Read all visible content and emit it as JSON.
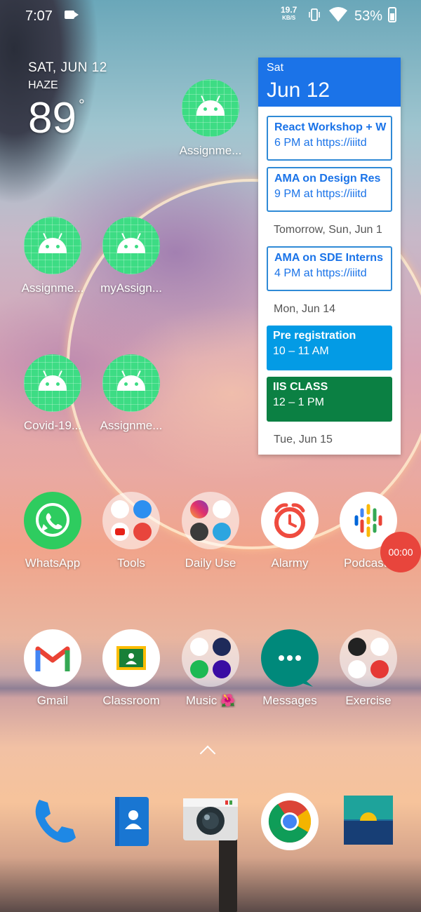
{
  "status_bar": {
    "time": "7:07",
    "net_speed": "19.7",
    "net_unit": "KB/S",
    "battery": "53%"
  },
  "weather": {
    "date": "SAT, JUN 12",
    "condition": "HAZE",
    "temperature": "89",
    "degree": "°"
  },
  "calendar": {
    "day": "Sat",
    "date": "Jun 12",
    "events": [
      {
        "title": "React Workshop + W",
        "time": "6 PM at https://iiitd"
      },
      {
        "title": "AMA on Design Res",
        "time": "9 PM at https://iiitd"
      }
    ],
    "tomorrow_label": "Tomorrow, Sun, Jun 1",
    "tomorrow_events": [
      {
        "title": "AMA on SDE Interns",
        "time": "4 PM at https://iiitd"
      }
    ],
    "mon_label": "Mon, Jun 14",
    "mon_events": [
      {
        "title": "Pre registration",
        "time": "10 – 11 AM"
      },
      {
        "title": "IIS CLASS",
        "time": "12 – 1 PM"
      }
    ],
    "tue_label": "Tue, Jun 15"
  },
  "apps": {
    "assign_top": "Assignme...",
    "assign_a": "Assignme...",
    "my_assign": "myAssign...",
    "covid": "Covid-19...",
    "assign_b": "Assignme...",
    "whatsapp": "WhatsApp",
    "tools": "Tools",
    "daily_use": "Daily Use",
    "alarmy": "Alarmy",
    "podcasts": "Podcasts",
    "gmail": "Gmail",
    "classroom": "Classroom",
    "music": "Music 🌺",
    "messages": "Messages",
    "exercise": "Exercise"
  },
  "timer": "00:00",
  "colors": {
    "calendar_header": "#1b73e8",
    "event_blue": "#039be5",
    "event_green": "#0b8043",
    "android_green": "#3ddc84",
    "timer_red": "#e8453c"
  }
}
